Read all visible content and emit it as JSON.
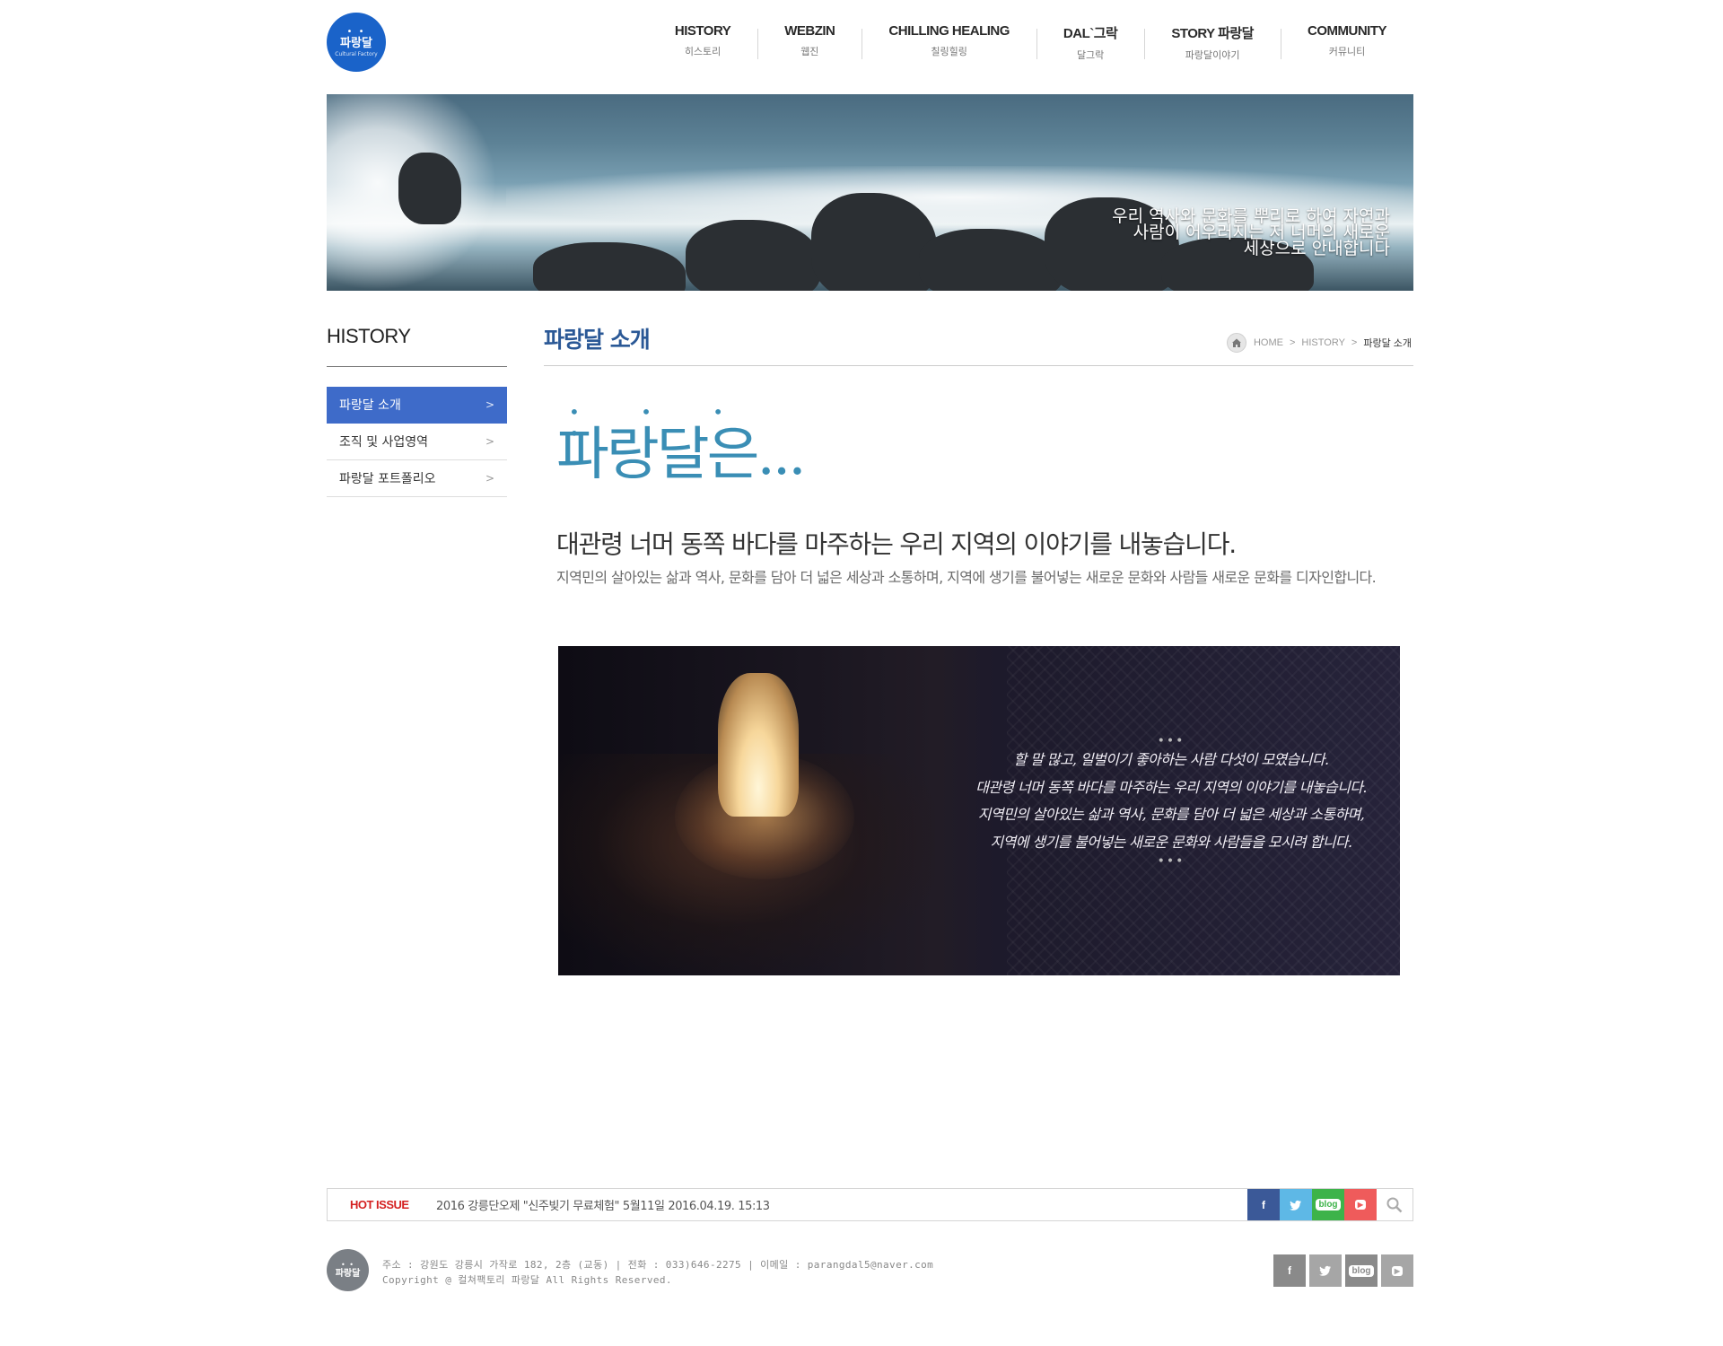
{
  "logo": {
    "name": "파랑달",
    "sub": "Cultural Factory"
  },
  "gnb": [
    {
      "en": "HISTORY",
      "ko": "히스토리"
    },
    {
      "en": "WEBZIN",
      "ko": "웹진"
    },
    {
      "en": "CHILLING HEALING",
      "ko": "칠링힐링"
    },
    {
      "en": "DAL`그락",
      "ko": "달그락"
    },
    {
      "en": "STORY 파랑달",
      "ko": "파랑달이야기"
    },
    {
      "en": "COMMUNITY",
      "ko": "커뮤니티"
    }
  ],
  "visual": {
    "copy_line1": "우리 역사와 문화를 뿌리로 하여 자연과",
    "copy_line2": "사람이 어우러지는 저 너머의 새로운",
    "copy_line3": "세상으로 안내합니다"
  },
  "lnb": {
    "title": "HISTORY",
    "items": [
      {
        "label": "파랑달 소개",
        "active": true
      },
      {
        "label": "조직 및 사업영역",
        "active": false
      },
      {
        "label": "파랑달 포트폴리오",
        "active": false
      }
    ]
  },
  "content": {
    "page_title": "파랑달 소개",
    "breadcrumb": {
      "home": "HOME",
      "section": "HISTORY",
      "current": "파랑달 소개"
    },
    "intro_title": "파랑달은...",
    "intro_lead": "대관령 너머 동쪽 바다를 마주하는 우리 지역의 이야기를 내놓습니다.",
    "intro_body": "지역민의 살아있는 삶과 역사, 문화를 담아 더 넓은 세상과 소통하며, 지역에 생기를 불어넣는 새로운 문화와 사람들 새로운 문화를 디자인합니다.",
    "quote_dots": "•••",
    "quote_lines": [
      "할 말 많고, 일벌이기 좋아하는 사람 다섯이 모였습니다.",
      "대관령 너머 동쪽 바다를 마주하는 우리 지역의 이야기를 내놓습니다.",
      "지역민의 살아있는 삶과 역사, 문화를 담아 더 넓은 세상과 소통하며,",
      "지역에 생기를 불어넣는 새로운 문화와 사람들을 모시려 합니다."
    ]
  },
  "hotissue": {
    "label": "HOT ISSUE",
    "text": "2016 강릉단오제 \"신주빚기 무료체험\" 5월11일 2016.04.19. 15:13"
  },
  "sns": {
    "facebook": "f",
    "twitter": "t",
    "blog": "blog",
    "youtube": "▶",
    "colors": {
      "facebook": "#3b5998",
      "twitter": "#5eb8e6",
      "blog": "#3db34a",
      "youtube": "#ef5b5b"
    }
  },
  "footer": {
    "address": "주소 : 강원도 강릉시 가작로 182, 2층 (교동) | 전화 : 033)646-2275  | 이메일 : parangdal5@naver.com",
    "copyright": "Copyright @ 컬쳐팩토리 파랑달 All Rights Reserved."
  }
}
